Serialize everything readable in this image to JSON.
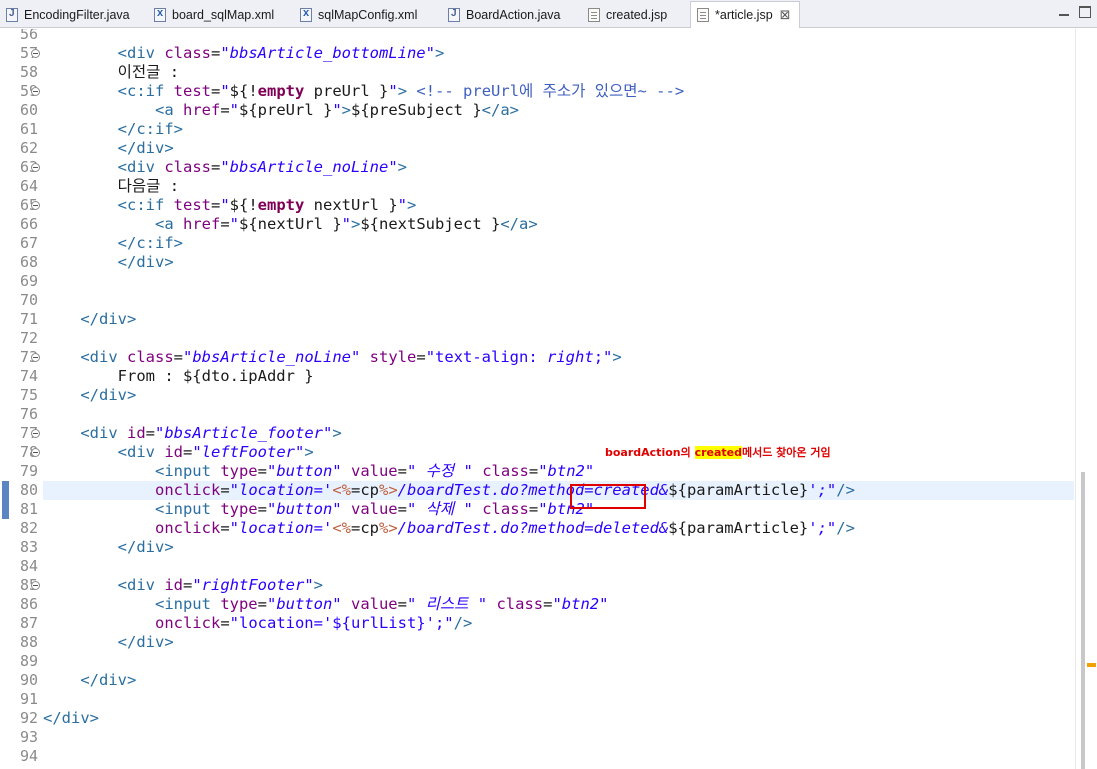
{
  "tabs": [
    {
      "label": "EncodingFilter.java",
      "icon": "java-file-icon",
      "active": false
    },
    {
      "label": "board_sqlMap.xml",
      "icon": "xml-file-icon",
      "active": false
    },
    {
      "label": "sqlMapConfig.xml",
      "icon": "xml-file-icon",
      "active": false
    },
    {
      "label": "BoardAction.java",
      "icon": "java-file-icon",
      "active": false
    },
    {
      "label": "created.jsp",
      "icon": "jsp-file-icon",
      "active": false
    },
    {
      "label": "*article.jsp",
      "icon": "jsp-file-icon",
      "active": true,
      "close": "⊠"
    }
  ],
  "current_line": 80,
  "folding_lines": [
    57,
    59,
    63,
    65,
    73,
    77,
    78,
    85
  ],
  "lines": [
    {
      "n": 56,
      "tokens": []
    },
    {
      "n": 57,
      "tokens": [
        [
          "el",
          "        "
        ],
        [
          "t",
          "<div "
        ],
        [
          "a",
          "class"
        ],
        [
          "el",
          "="
        ],
        [
          "v",
          "\"bbsArticle_bottomLine\""
        ],
        [
          "t",
          ">"
        ]
      ]
    },
    {
      "n": 58,
      "tokens": [
        [
          "el",
          "        이전글 :"
        ]
      ]
    },
    {
      "n": 59,
      "tokens": [
        [
          "el",
          "        "
        ],
        [
          "t",
          "<c:if "
        ],
        [
          "a",
          "test"
        ],
        [
          "el",
          "="
        ],
        [
          "vp",
          "\""
        ],
        [
          "el",
          "${!"
        ],
        [
          "k",
          "empty"
        ],
        [
          "el",
          " preUrl }"
        ],
        [
          "vp",
          "\""
        ],
        [
          "t",
          ">"
        ],
        [
          "el",
          " "
        ],
        [
          "cm",
          "<!-- preUrl에 주소가 있으면~ -->"
        ]
      ]
    },
    {
      "n": 60,
      "tokens": [
        [
          "el",
          "            "
        ],
        [
          "t",
          "<a "
        ],
        [
          "a",
          "href"
        ],
        [
          "el",
          "="
        ],
        [
          "vp",
          "\""
        ],
        [
          "el",
          "${preUrl }"
        ],
        [
          "vp",
          "\""
        ],
        [
          "t",
          ">"
        ],
        [
          "el",
          "${preSubject }"
        ],
        [
          "t",
          "</a>"
        ]
      ]
    },
    {
      "n": 61,
      "tokens": [
        [
          "el",
          "        "
        ],
        [
          "t",
          "</c:if>"
        ]
      ]
    },
    {
      "n": 62,
      "tokens": [
        [
          "el",
          "        "
        ],
        [
          "t",
          "</div>"
        ]
      ]
    },
    {
      "n": 63,
      "tokens": [
        [
          "el",
          "        "
        ],
        [
          "t",
          "<div "
        ],
        [
          "a",
          "class"
        ],
        [
          "el",
          "="
        ],
        [
          "v",
          "\"bbsArticle_noLine\""
        ],
        [
          "t",
          ">"
        ]
      ]
    },
    {
      "n": 64,
      "tokens": [
        [
          "el",
          "        다음글 :"
        ]
      ]
    },
    {
      "n": 65,
      "tokens": [
        [
          "el",
          "        "
        ],
        [
          "t",
          "<c:if "
        ],
        [
          "a",
          "test"
        ],
        [
          "el",
          "="
        ],
        [
          "vp",
          "\""
        ],
        [
          "el",
          "${!"
        ],
        [
          "k",
          "empty"
        ],
        [
          "el",
          " nextUrl }"
        ],
        [
          "vp",
          "\""
        ],
        [
          "t",
          ">"
        ]
      ]
    },
    {
      "n": 66,
      "tokens": [
        [
          "el",
          "            "
        ],
        [
          "t",
          "<a "
        ],
        [
          "a",
          "href"
        ],
        [
          "el",
          "="
        ],
        [
          "vp",
          "\""
        ],
        [
          "el",
          "${nextUrl }"
        ],
        [
          "vp",
          "\""
        ],
        [
          "t",
          ">"
        ],
        [
          "el",
          "${nextSubject }"
        ],
        [
          "t",
          "</a>"
        ]
      ]
    },
    {
      "n": 67,
      "tokens": [
        [
          "el",
          "        "
        ],
        [
          "t",
          "</c:if>"
        ]
      ]
    },
    {
      "n": 68,
      "tokens": [
        [
          "el",
          "        "
        ],
        [
          "t",
          "</div>"
        ]
      ]
    },
    {
      "n": 69,
      "tokens": []
    },
    {
      "n": 70,
      "tokens": []
    },
    {
      "n": 71,
      "tokens": [
        [
          "el",
          "    "
        ],
        [
          "t",
          "</div>"
        ]
      ]
    },
    {
      "n": 72,
      "tokens": []
    },
    {
      "n": 73,
      "tokens": [
        [
          "el",
          "    "
        ],
        [
          "t",
          "<div "
        ],
        [
          "a",
          "class"
        ],
        [
          "el",
          "="
        ],
        [
          "v",
          "\"bbsArticle_noLine\""
        ],
        [
          "el",
          " "
        ],
        [
          "a",
          "style"
        ],
        [
          "el",
          "="
        ],
        [
          "vp",
          "\"text-align: "
        ],
        [
          "v",
          "right"
        ],
        [
          "vp",
          ";\""
        ],
        [
          "t",
          ">"
        ]
      ]
    },
    {
      "n": 74,
      "tokens": [
        [
          "el",
          "        From : ${dto.ipAddr }"
        ]
      ]
    },
    {
      "n": 75,
      "tokens": [
        [
          "el",
          "    "
        ],
        [
          "t",
          "</div>"
        ]
      ]
    },
    {
      "n": 76,
      "tokens": []
    },
    {
      "n": 77,
      "tokens": [
        [
          "el",
          "    "
        ],
        [
          "t",
          "<div "
        ],
        [
          "a",
          "id"
        ],
        [
          "el",
          "="
        ],
        [
          "v",
          "\"bbsArticle_footer\""
        ],
        [
          "t",
          ">"
        ]
      ]
    },
    {
      "n": 78,
      "tokens": [
        [
          "el",
          "        "
        ],
        [
          "t",
          "<div "
        ],
        [
          "a",
          "id"
        ],
        [
          "el",
          "="
        ],
        [
          "v",
          "\"leftFooter\""
        ],
        [
          "t",
          ">"
        ]
      ]
    },
    {
      "n": 79,
      "tokens": [
        [
          "el",
          "            "
        ],
        [
          "t",
          "<input "
        ],
        [
          "a",
          "type"
        ],
        [
          "el",
          "="
        ],
        [
          "v",
          "\"button\""
        ],
        [
          "el",
          " "
        ],
        [
          "a",
          "value"
        ],
        [
          "el",
          "="
        ],
        [
          "v",
          "\" 수정 \""
        ],
        [
          "el",
          " "
        ],
        [
          "a",
          "class"
        ],
        [
          "el",
          "="
        ],
        [
          "v",
          "\"btn2\""
        ]
      ]
    },
    {
      "n": 80,
      "tokens": [
        [
          "el",
          "            "
        ],
        [
          "a",
          "onclick"
        ],
        [
          "el",
          "="
        ],
        [
          "v",
          "\"location='"
        ],
        [
          "pct",
          "<%"
        ],
        [
          "el",
          "=cp"
        ],
        [
          "pct",
          "%>"
        ],
        [
          "v",
          "/boardTest.do?method=created&"
        ],
        [
          "el",
          "${paramArticle}"
        ],
        [
          "v",
          "';\""
        ],
        [
          "t",
          "/>"
        ]
      ]
    },
    {
      "n": 81,
      "tokens": [
        [
          "el",
          "            "
        ],
        [
          "t",
          "<input "
        ],
        [
          "a",
          "type"
        ],
        [
          "el",
          "="
        ],
        [
          "v",
          "\"button\""
        ],
        [
          "el",
          " "
        ],
        [
          "a",
          "value"
        ],
        [
          "el",
          "="
        ],
        [
          "v",
          "\" 삭제 \""
        ],
        [
          "el",
          " "
        ],
        [
          "a",
          "class"
        ],
        [
          "el",
          "="
        ],
        [
          "v",
          "\"btn2\""
        ]
      ]
    },
    {
      "n": 82,
      "tokens": [
        [
          "el",
          "            "
        ],
        [
          "a",
          "onclick"
        ],
        [
          "el",
          "="
        ],
        [
          "v",
          "\"location='"
        ],
        [
          "pct",
          "<%"
        ],
        [
          "el",
          "=cp"
        ],
        [
          "pct",
          "%>"
        ],
        [
          "v",
          "/boardTest.do?method=deleted&"
        ],
        [
          "el",
          "${paramArticle}"
        ],
        [
          "v",
          "';\""
        ],
        [
          "t",
          "/>"
        ]
      ]
    },
    {
      "n": 83,
      "tokens": [
        [
          "el",
          "        "
        ],
        [
          "t",
          "</div>"
        ]
      ]
    },
    {
      "n": 84,
      "tokens": []
    },
    {
      "n": 85,
      "tokens": [
        [
          "el",
          "        "
        ],
        [
          "t",
          "<div "
        ],
        [
          "a",
          "id"
        ],
        [
          "el",
          "="
        ],
        [
          "v",
          "\"rightFooter\""
        ],
        [
          "t",
          ">"
        ]
      ]
    },
    {
      "n": 86,
      "tokens": [
        [
          "el",
          "            "
        ],
        [
          "t",
          "<input "
        ],
        [
          "a",
          "type"
        ],
        [
          "el",
          "="
        ],
        [
          "v",
          "\"button\""
        ],
        [
          "el",
          " "
        ],
        [
          "a",
          "value"
        ],
        [
          "el",
          "="
        ],
        [
          "v",
          "\" 리스트 \""
        ],
        [
          "el",
          " "
        ],
        [
          "a",
          "class"
        ],
        [
          "el",
          "="
        ],
        [
          "v",
          "\"btn2\""
        ]
      ]
    },
    {
      "n": 87,
      "tokens": [
        [
          "el",
          "            "
        ],
        [
          "a",
          "onclick"
        ],
        [
          "el",
          "="
        ],
        [
          "vp",
          "\"location='${urlList}';\""
        ],
        [
          "t",
          "/>"
        ]
      ]
    },
    {
      "n": 88,
      "tokens": [
        [
          "el",
          "        "
        ],
        [
          "t",
          "</div>"
        ]
      ]
    },
    {
      "n": 89,
      "tokens": []
    },
    {
      "n": 90,
      "tokens": [
        [
          "el",
          "    "
        ],
        [
          "t",
          "</div>"
        ]
      ]
    },
    {
      "n": 91,
      "tokens": []
    },
    {
      "n": 92,
      "tokens": [
        [
          "t",
          "</div>"
        ]
      ]
    },
    {
      "n": 93,
      "tokens": []
    },
    {
      "n": 94,
      "tokens": []
    }
  ],
  "annotation": {
    "before": "boardAction의 ",
    "highlight": "created",
    "after": "메서드 찾아온 거임",
    "color": "#e00000"
  },
  "colors": {
    "tag": "#2a6ea0",
    "attribute": "#7f007f",
    "string": "#2a00ff",
    "keyword": "#7f0055",
    "comment": "#3f5fbf",
    "current_line_bg": "#e8f2fe"
  }
}
